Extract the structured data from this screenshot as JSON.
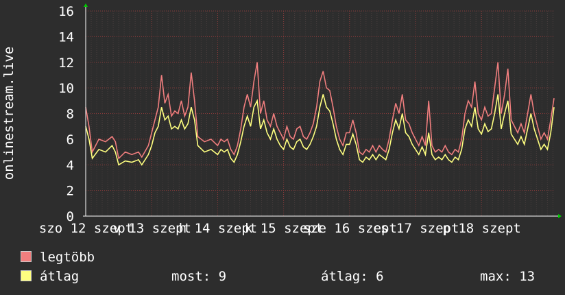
{
  "chart_data": {
    "type": "line",
    "ylabel": "onlinestream.live",
    "ylim": [
      0,
      16
    ],
    "yticks": [
      0,
      2,
      4,
      6,
      8,
      10,
      12,
      14,
      16
    ],
    "xlim": [
      12,
      19.1
    ],
    "x_tick_labels": [
      {
        "x": 12,
        "label": "szo 12 szept"
      },
      {
        "x": 13,
        "label": "v 13 szept"
      },
      {
        "x": 14,
        "label": "h 14 szept"
      },
      {
        "x": 15,
        "label": "k 15 szept"
      },
      {
        "x": 16,
        "label": "sze 16 szept"
      },
      {
        "x": 17,
        "label": "cs 17 szept"
      },
      {
        "x": 18,
        "label": "p 18 szept"
      }
    ],
    "grid": true,
    "series": [
      {
        "name": "legtöbb",
        "color": "#f07e7e",
        "points": [
          [
            12,
            8.5
          ],
          [
            12.05,
            7.0
          ],
          [
            12.1,
            5.0
          ],
          [
            12.2,
            6.0
          ],
          [
            12.3,
            5.8
          ],
          [
            12.4,
            6.2
          ],
          [
            12.45,
            5.8
          ],
          [
            12.5,
            4.5
          ],
          [
            12.6,
            5.0
          ],
          [
            12.7,
            4.8
          ],
          [
            12.8,
            5.0
          ],
          [
            12.85,
            4.6
          ],
          [
            12.95,
            5.5
          ],
          [
            13.0,
            6.5
          ],
          [
            13.05,
            7.5
          ],
          [
            13.1,
            8.5
          ],
          [
            13.15,
            11.0
          ],
          [
            13.2,
            8.8
          ],
          [
            13.25,
            9.5
          ],
          [
            13.3,
            7.8
          ],
          [
            13.35,
            8.2
          ],
          [
            13.4,
            8.0
          ],
          [
            13.45,
            9.0
          ],
          [
            13.5,
            7.8
          ],
          [
            13.55,
            8.5
          ],
          [
            13.6,
            11.2
          ],
          [
            13.65,
            9.0
          ],
          [
            13.7,
            6.2
          ],
          [
            13.8,
            5.8
          ],
          [
            13.9,
            6.0
          ],
          [
            14.0,
            5.5
          ],
          [
            14.05,
            6.0
          ],
          [
            14.1,
            5.8
          ],
          [
            14.15,
            6.0
          ],
          [
            14.2,
            5.2
          ],
          [
            14.25,
            4.8
          ],
          [
            14.3,
            5.5
          ],
          [
            14.35,
            6.8
          ],
          [
            14.4,
            8.5
          ],
          [
            14.45,
            9.5
          ],
          [
            14.5,
            8.5
          ],
          [
            14.55,
            10.5
          ],
          [
            14.6,
            12.0
          ],
          [
            14.65,
            8.0
          ],
          [
            14.7,
            9.0
          ],
          [
            14.75,
            7.5
          ],
          [
            14.8,
            7.0
          ],
          [
            14.85,
            8.0
          ],
          [
            14.9,
            7.0
          ],
          [
            14.95,
            6.5
          ],
          [
            15.0,
            6.0
          ],
          [
            15.05,
            7.0
          ],
          [
            15.1,
            6.2
          ],
          [
            15.15,
            6.0
          ],
          [
            15.2,
            6.8
          ],
          [
            15.25,
            7.0
          ],
          [
            15.3,
            6.2
          ],
          [
            15.35,
            6.0
          ],
          [
            15.4,
            6.5
          ],
          [
            15.45,
            7.2
          ],
          [
            15.5,
            8.5
          ],
          [
            15.55,
            10.5
          ],
          [
            15.6,
            11.3
          ],
          [
            15.65,
            10.0
          ],
          [
            15.7,
            9.8
          ],
          [
            15.75,
            8.5
          ],
          [
            15.8,
            7.0
          ],
          [
            15.85,
            6.0
          ],
          [
            15.9,
            5.5
          ],
          [
            15.95,
            6.5
          ],
          [
            16.0,
            6.5
          ],
          [
            16.05,
            7.5
          ],
          [
            16.1,
            6.5
          ],
          [
            16.15,
            5.0
          ],
          [
            16.2,
            4.8
          ],
          [
            16.25,
            5.2
          ],
          [
            16.3,
            5.0
          ],
          [
            16.35,
            5.5
          ],
          [
            16.4,
            5.0
          ],
          [
            16.45,
            5.5
          ],
          [
            16.5,
            5.2
          ],
          [
            16.55,
            5.0
          ],
          [
            16.6,
            6.0
          ],
          [
            16.65,
            7.5
          ],
          [
            16.7,
            8.8
          ],
          [
            16.75,
            8.0
          ],
          [
            16.8,
            9.5
          ],
          [
            16.85,
            7.5
          ],
          [
            16.9,
            7.2
          ],
          [
            16.95,
            6.5
          ],
          [
            17.0,
            6.0
          ],
          [
            17.05,
            5.5
          ],
          [
            17.1,
            6.2
          ],
          [
            17.15,
            5.5
          ],
          [
            17.2,
            9.0
          ],
          [
            17.25,
            5.5
          ],
          [
            17.3,
            5.0
          ],
          [
            17.35,
            5.2
          ],
          [
            17.4,
            5.0
          ],
          [
            17.45,
            5.5
          ],
          [
            17.5,
            5.0
          ],
          [
            17.55,
            4.8
          ],
          [
            17.6,
            5.2
          ],
          [
            17.65,
            5.0
          ],
          [
            17.7,
            6.0
          ],
          [
            17.75,
            8.0
          ],
          [
            17.8,
            9.0
          ],
          [
            17.85,
            8.5
          ],
          [
            17.9,
            10.5
          ],
          [
            17.95,
            8.0
          ],
          [
            18.0,
            7.5
          ],
          [
            18.05,
            8.5
          ],
          [
            18.1,
            7.8
          ],
          [
            18.15,
            8.0
          ],
          [
            18.2,
            10.0
          ],
          [
            18.25,
            12.0
          ],
          [
            18.3,
            8.0
          ],
          [
            18.35,
            9.5
          ],
          [
            18.4,
            11.5
          ],
          [
            18.45,
            7.5
          ],
          [
            18.5,
            7.0
          ],
          [
            18.55,
            6.5
          ],
          [
            18.6,
            7.2
          ],
          [
            18.65,
            6.5
          ],
          [
            18.7,
            8.0
          ],
          [
            18.75,
            9.5
          ],
          [
            18.8,
            8.0
          ],
          [
            18.85,
            7.0
          ],
          [
            18.9,
            6.0
          ],
          [
            18.95,
            6.5
          ],
          [
            19.0,
            6.0
          ],
          [
            19.05,
            7.5
          ],
          [
            19.1,
            9.2
          ]
        ]
      },
      {
        "name": "átlag",
        "color": "#ffff80",
        "points": [
          [
            12,
            7.0
          ],
          [
            12.05,
            6.0
          ],
          [
            12.1,
            4.5
          ],
          [
            12.2,
            5.2
          ],
          [
            12.3,
            5.0
          ],
          [
            12.4,
            5.5
          ],
          [
            12.45,
            5.0
          ],
          [
            12.5,
            4.0
          ],
          [
            12.6,
            4.3
          ],
          [
            12.7,
            4.2
          ],
          [
            12.8,
            4.4
          ],
          [
            12.85,
            4.0
          ],
          [
            12.95,
            4.8
          ],
          [
            13.0,
            5.5
          ],
          [
            13.05,
            6.5
          ],
          [
            13.1,
            7.0
          ],
          [
            13.15,
            8.5
          ],
          [
            13.2,
            7.5
          ],
          [
            13.25,
            7.8
          ],
          [
            13.3,
            6.8
          ],
          [
            13.35,
            7.0
          ],
          [
            13.4,
            6.8
          ],
          [
            13.45,
            7.5
          ],
          [
            13.5,
            6.8
          ],
          [
            13.55,
            7.2
          ],
          [
            13.6,
            8.5
          ],
          [
            13.65,
            7.5
          ],
          [
            13.7,
            5.5
          ],
          [
            13.8,
            5.0
          ],
          [
            13.9,
            5.2
          ],
          [
            14.0,
            4.8
          ],
          [
            14.05,
            5.2
          ],
          [
            14.1,
            5.0
          ],
          [
            14.15,
            5.2
          ],
          [
            14.2,
            4.5
          ],
          [
            14.25,
            4.2
          ],
          [
            14.3,
            4.8
          ],
          [
            14.35,
            5.8
          ],
          [
            14.4,
            7.0
          ],
          [
            14.45,
            7.8
          ],
          [
            14.5,
            7.0
          ],
          [
            14.55,
            8.5
          ],
          [
            14.6,
            9.0
          ],
          [
            14.65,
            6.8
          ],
          [
            14.7,
            7.5
          ],
          [
            14.75,
            6.5
          ],
          [
            14.8,
            6.0
          ],
          [
            14.85,
            6.8
          ],
          [
            14.9,
            6.0
          ],
          [
            14.95,
            5.5
          ],
          [
            15.0,
            5.2
          ],
          [
            15.05,
            6.0
          ],
          [
            15.1,
            5.4
          ],
          [
            15.15,
            5.2
          ],
          [
            15.2,
            5.8
          ],
          [
            15.25,
            6.0
          ],
          [
            15.3,
            5.4
          ],
          [
            15.35,
            5.2
          ],
          [
            15.4,
            5.6
          ],
          [
            15.45,
            6.2
          ],
          [
            15.5,
            7.0
          ],
          [
            15.55,
            8.5
          ],
          [
            15.6,
            9.5
          ],
          [
            15.65,
            8.5
          ],
          [
            15.7,
            8.2
          ],
          [
            15.75,
            7.2
          ],
          [
            15.8,
            6.0
          ],
          [
            15.85,
            5.2
          ],
          [
            15.9,
            4.8
          ],
          [
            15.95,
            5.6
          ],
          [
            16.0,
            5.6
          ],
          [
            16.05,
            6.4
          ],
          [
            16.1,
            5.6
          ],
          [
            16.15,
            4.4
          ],
          [
            16.2,
            4.2
          ],
          [
            16.25,
            4.6
          ],
          [
            16.3,
            4.4
          ],
          [
            16.35,
            4.8
          ],
          [
            16.4,
            4.4
          ],
          [
            16.45,
            4.8
          ],
          [
            16.5,
            4.6
          ],
          [
            16.55,
            4.4
          ],
          [
            16.6,
            5.2
          ],
          [
            16.65,
            6.5
          ],
          [
            16.7,
            7.5
          ],
          [
            16.75,
            6.8
          ],
          [
            16.8,
            8.0
          ],
          [
            16.85,
            6.5
          ],
          [
            16.9,
            6.2
          ],
          [
            16.95,
            5.6
          ],
          [
            17.0,
            5.2
          ],
          [
            17.05,
            4.8
          ],
          [
            17.1,
            5.4
          ],
          [
            17.15,
            4.8
          ],
          [
            17.2,
            6.5
          ],
          [
            17.25,
            4.8
          ],
          [
            17.3,
            4.4
          ],
          [
            17.35,
            4.6
          ],
          [
            17.4,
            4.4
          ],
          [
            17.45,
            4.8
          ],
          [
            17.5,
            4.4
          ],
          [
            17.55,
            4.2
          ],
          [
            17.6,
            4.6
          ],
          [
            17.65,
            4.4
          ],
          [
            17.7,
            5.2
          ],
          [
            17.75,
            6.8
          ],
          [
            17.8,
            7.5
          ],
          [
            17.85,
            7.0
          ],
          [
            17.9,
            8.5
          ],
          [
            17.95,
            6.8
          ],
          [
            18.0,
            6.4
          ],
          [
            18.05,
            7.2
          ],
          [
            18.1,
            6.6
          ],
          [
            18.15,
            6.8
          ],
          [
            18.2,
            8.0
          ],
          [
            18.25,
            9.5
          ],
          [
            18.3,
            6.8
          ],
          [
            18.35,
            8.0
          ],
          [
            18.4,
            9.0
          ],
          [
            18.45,
            6.4
          ],
          [
            18.5,
            6.0
          ],
          [
            18.55,
            5.6
          ],
          [
            18.6,
            6.2
          ],
          [
            18.65,
            5.6
          ],
          [
            18.7,
            6.8
          ],
          [
            18.75,
            8.0
          ],
          [
            18.8,
            6.8
          ],
          [
            18.85,
            6.0
          ],
          [
            18.9,
            5.2
          ],
          [
            18.95,
            5.6
          ],
          [
            19.0,
            5.2
          ],
          [
            19.05,
            6.5
          ],
          [
            19.1,
            8.5
          ]
        ]
      }
    ],
    "legend": [
      {
        "label": "legtöbb",
        "color": "#f07e7e"
      },
      {
        "label": "átlag",
        "color": "#ffff80"
      }
    ],
    "stats": {
      "most": "most: 9",
      "atlag": "átlag: 6",
      "max": "max: 13"
    }
  }
}
